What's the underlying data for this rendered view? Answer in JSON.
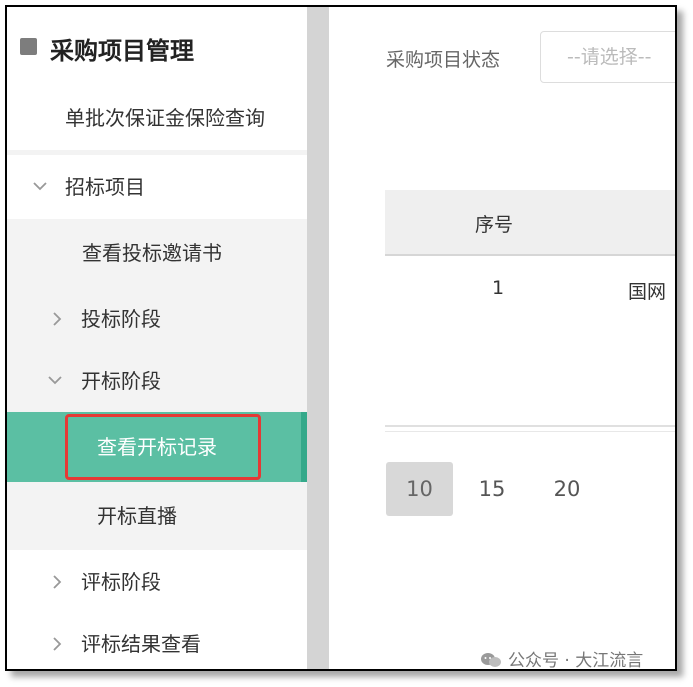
{
  "sidebar": {
    "title": "采购项目管理",
    "items": [
      {
        "label": "单批次保证金保险查询"
      },
      {
        "label": "招标项目"
      },
      {
        "label": "查看投标邀请书"
      },
      {
        "label": "投标阶段"
      },
      {
        "label": "开标阶段"
      },
      {
        "label": "查看开标记录"
      },
      {
        "label": "开标直播"
      },
      {
        "label": "评标阶段"
      },
      {
        "label": "评标结果查看"
      }
    ]
  },
  "filter": {
    "label": "采购项目状态",
    "placeholder": "--请选择--"
  },
  "table": {
    "headers": [
      "序号"
    ],
    "rows": [
      {
        "no": "1",
        "name": "国网"
      }
    ]
  },
  "pagination": {
    "sizes": [
      "10",
      "15",
      "20"
    ],
    "selected": "10"
  },
  "watermark": "公众号 · 大江流言",
  "colors": {
    "accent": "#5bbfa3",
    "highlight": "#e53935"
  }
}
